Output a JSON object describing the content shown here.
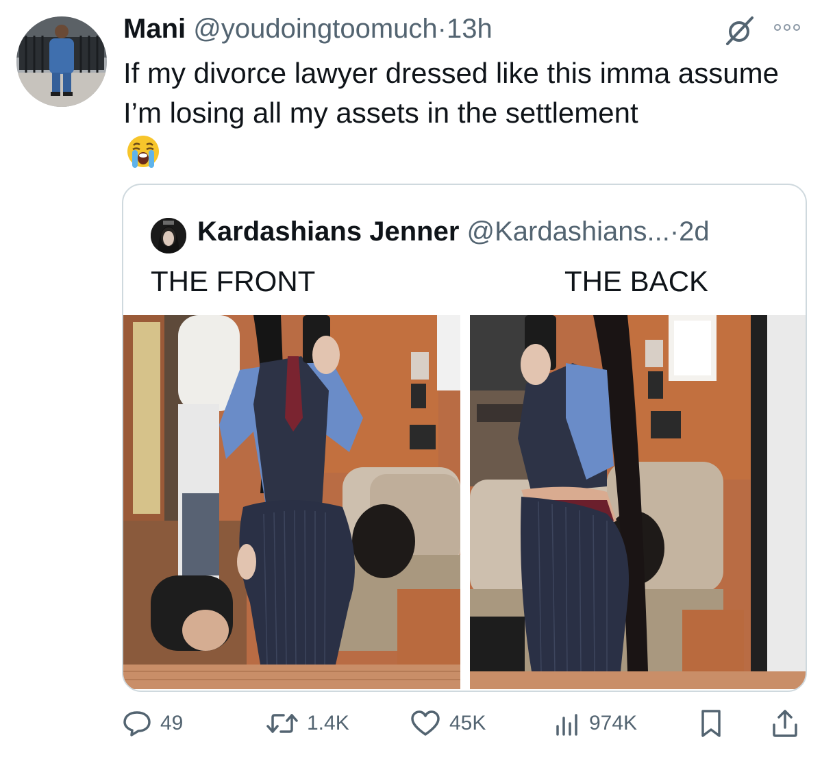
{
  "tweet": {
    "display_name": "Mani",
    "handle": "@youdoingtoomuch",
    "separator": "·",
    "time": "13h",
    "text": "If my divorce lawyer dressed like this imma assume I’m losing all my assets in the settlement",
    "emoji": "loudly-crying-face"
  },
  "quoted_tweet": {
    "display_name": "Kardashians Jenner",
    "handle": "@Kardashians...",
    "separator": "·",
    "time": "2d",
    "caption_left": "THE FRONT",
    "caption_right": "THE BACK"
  },
  "actions": {
    "replies": "49",
    "reposts": "1.4K",
    "likes": "45K",
    "views": "974K"
  },
  "icons": {
    "reply": "speech-bubble-icon",
    "repost": "repost-arrows-icon",
    "like": "heart-icon",
    "views": "bar-chart-icon",
    "bookmark": "bookmark-icon",
    "share": "share-upload-icon",
    "grok": "grok-slash-circle-icon",
    "more": "ellipsis-icon"
  },
  "colors": {
    "text_primary": "#0f1419",
    "text_secondary": "#536471",
    "border": "#cfd9de"
  }
}
